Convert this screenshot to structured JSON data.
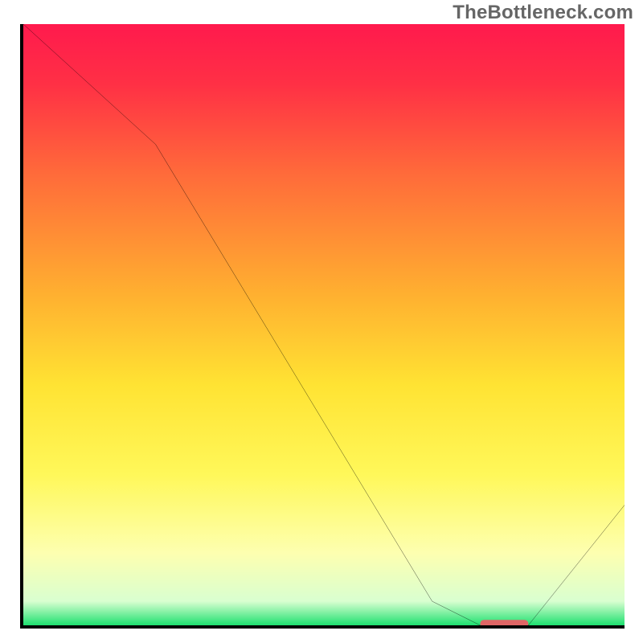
{
  "watermark": "TheBottleneck.com",
  "chart_data": {
    "type": "line",
    "title": "",
    "xlabel": "",
    "ylabel": "",
    "xlim": [
      0,
      100
    ],
    "ylim": [
      0,
      100
    ],
    "x": [
      0,
      22,
      68,
      76,
      84,
      100
    ],
    "values": [
      100,
      80,
      4,
      0,
      0,
      20
    ],
    "marker": {
      "x_start": 76,
      "x_end": 84,
      "y": 0,
      "color": "#e06666"
    },
    "gradient_stops": [
      {
        "offset": 0.0,
        "color": "#ff1a4d"
      },
      {
        "offset": 0.1,
        "color": "#ff3045"
      },
      {
        "offset": 0.25,
        "color": "#ff6b3a"
      },
      {
        "offset": 0.45,
        "color": "#ffb030"
      },
      {
        "offset": 0.6,
        "color": "#ffe333"
      },
      {
        "offset": 0.75,
        "color": "#fff85a"
      },
      {
        "offset": 0.88,
        "color": "#fdffb0"
      },
      {
        "offset": 0.96,
        "color": "#d9ffd0"
      },
      {
        "offset": 1.0,
        "color": "#1ee070"
      }
    ]
  }
}
